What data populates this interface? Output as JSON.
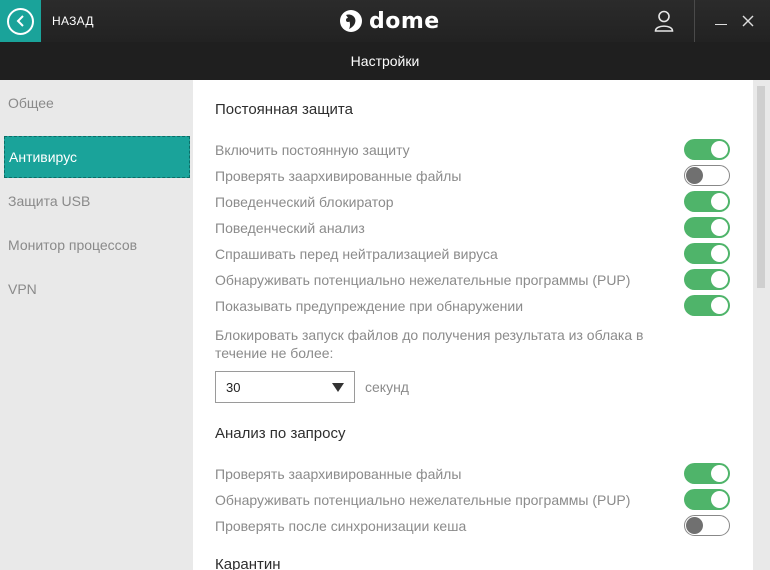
{
  "header": {
    "back_label": "НАЗАД",
    "logo_text": "dome",
    "logo_brand_small": "Panda"
  },
  "subheader": {
    "title": "Настройки"
  },
  "sidebar": {
    "items": [
      {
        "label": "Общее",
        "active": false
      },
      {
        "label": "Антивирус",
        "active": true
      },
      {
        "label": "Защита USB",
        "active": false
      },
      {
        "label": "Монитор процессов",
        "active": false
      },
      {
        "label": "VPN",
        "active": false
      }
    ]
  },
  "permanent_protection": {
    "title": "Постоянная защита",
    "settings": [
      {
        "label": "Включить постоянную защиту",
        "enabled": true
      },
      {
        "label": "Проверять заархивированные файлы",
        "enabled": false
      },
      {
        "label": "Поведенческий блокиратор",
        "enabled": true
      },
      {
        "label": "Поведенческий анализ",
        "enabled": true
      },
      {
        "label": "Спрашивать перед нейтрализацией вируса",
        "enabled": true
      },
      {
        "label": "Обнаруживать потенциально нежелательные программы (PUP)",
        "enabled": true
      },
      {
        "label": "Показывать предупреждение при обнаружении",
        "enabled": true
      }
    ],
    "cloud_block_text": "Блокировать запуск файлов до получения результата из облака в течение не более:",
    "cloud_block_value": "30",
    "cloud_block_unit": "секунд"
  },
  "on_demand": {
    "title": "Анализ по запросу",
    "settings": [
      {
        "label": "Проверять заархивированные файлы",
        "enabled": true
      },
      {
        "label": "Обнаруживать потенциально нежелательные программы (PUP)",
        "enabled": true
      },
      {
        "label": "Проверять после синхронизации кеша",
        "enabled": false
      }
    ]
  },
  "quarantine": {
    "title": "Карантин"
  },
  "colors": {
    "accent": "#1aa39a",
    "toggle_on": "#4fb46a",
    "header_bg": "#262626"
  }
}
